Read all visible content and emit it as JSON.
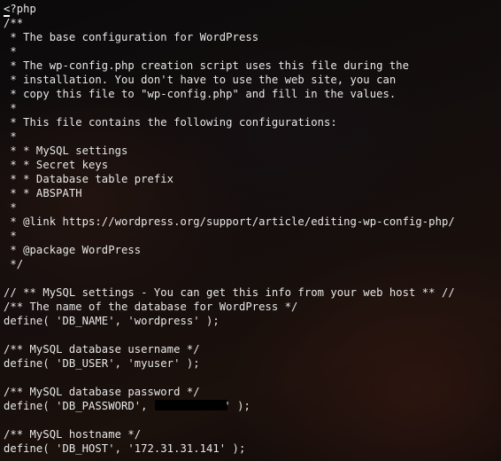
{
  "editor": {
    "cursor_char": "<",
    "lines": [
      "?php",
      "/**",
      " * The base configuration for WordPress",
      " *",
      " * The wp-config.php creation script uses this file during the",
      " * installation. You don't have to use the web site, you can",
      " * copy this file to \"wp-config.php\" and fill in the values.",
      " *",
      " * This file contains the following configurations:",
      " *",
      " * * MySQL settings",
      " * * Secret keys",
      " * * Database table prefix",
      " * * ABSPATH",
      " *",
      " * @link https://wordpress.org/support/article/editing-wp-config-php/",
      " *",
      " * @package WordPress",
      " */",
      "",
      "// ** MySQL settings - You can get this info from your web host ** //",
      "/** The name of the database for WordPress */",
      "define( 'DB_NAME', 'wordpress' );",
      "",
      "/** MySQL database username */",
      "define( 'DB_USER', 'myuser' );",
      "",
      "/** MySQL database password */",
      "",
      "",
      "/** MySQL hostname */",
      "define( 'DB_HOST', '172.31.31.141' );"
    ],
    "password_line": {
      "before": "define( 'DB_PASSWORD', '",
      "after": "' );"
    }
  }
}
